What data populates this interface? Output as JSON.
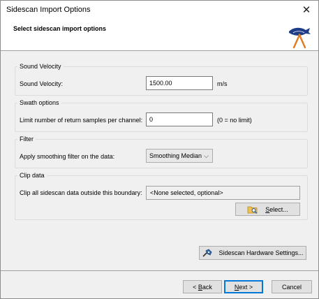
{
  "window": {
    "title": "Sidescan Import Options"
  },
  "header": {
    "title": "Select sidescan import options"
  },
  "groups": {
    "sound_velocity": {
      "legend": "Sound Velocity",
      "label": "Sound Velocity:",
      "value": "1500.00",
      "unit": "m/s"
    },
    "swath": {
      "legend": "Swath options",
      "label": "Limit number of return samples per channel:",
      "value": "0",
      "hint": "(0 = no limit)"
    },
    "filter": {
      "legend": "Filter",
      "label": "Apply smoothing filter on the data:",
      "selected": "Smoothing Median"
    },
    "clip": {
      "legend": "Clip data",
      "label": "Clip all sidescan data outside this boundary:",
      "value": "<None selected, optional>",
      "select_button": {
        "pre": "",
        "accel": "S",
        "post": "elect..."
      }
    }
  },
  "hardware_button": "Sidescan Hardware Settings...",
  "footer": {
    "back": {
      "pre": "< ",
      "accel": "B",
      "post": "ack"
    },
    "next": {
      "pre": "",
      "accel": "N",
      "post": "ext >"
    },
    "cancel": "Cancel"
  },
  "icons": {
    "close": "close-icon",
    "logo": "app-logo-icon",
    "select": "folder-search-icon",
    "hardware": "hardware-settings-icon"
  },
  "colors": {
    "accent": "#0078d7",
    "logo_blue": "#1f3c88",
    "logo_orange": "#e07a1f"
  }
}
